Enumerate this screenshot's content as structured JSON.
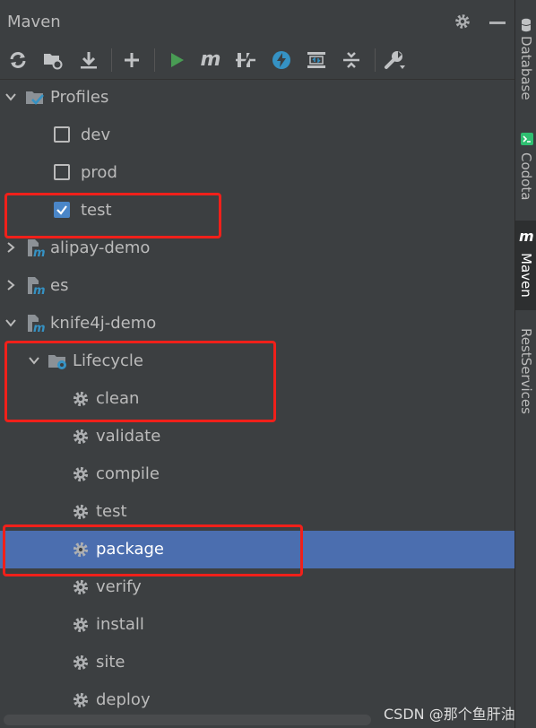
{
  "panel": {
    "title": "Maven"
  },
  "toolbar": {
    "buttons": [
      "reload-icon",
      "generate-sources-icon",
      "download-icon",
      "add-icon",
      "run-icon",
      "maven-goal-icon",
      "toggle-offline-icon",
      "skip-tests-icon",
      "show-dependencies-icon",
      "collapse-all-icon",
      "settings-wrench-icon"
    ]
  },
  "tree": {
    "profiles": {
      "label": "Profiles",
      "items": [
        {
          "label": "dev",
          "checked": false
        },
        {
          "label": "prod",
          "checked": false
        },
        {
          "label": "test",
          "checked": true
        }
      ]
    },
    "projects": [
      {
        "label": "alipay-demo",
        "expanded": false
      },
      {
        "label": "es",
        "expanded": false
      },
      {
        "label": "knife4j-demo",
        "expanded": true
      }
    ],
    "lifecycle": {
      "label": "Lifecycle",
      "goals": [
        "clean",
        "validate",
        "compile",
        "test",
        "package",
        "verify",
        "install",
        "site",
        "deploy"
      ],
      "selected": "package"
    }
  },
  "sidebar": {
    "tabs": [
      {
        "label": "Database",
        "icon": "database-icon"
      },
      {
        "label": "Codota",
        "icon": "codota-icon"
      },
      {
        "label": "Maven",
        "icon": "maven-icon",
        "active": true
      },
      {
        "label": "RestServices",
        "icon": ""
      }
    ]
  },
  "watermark": "CSDN @那个鱼肝油",
  "colors": {
    "selection": "#4b6eaf",
    "highlight_box": "#f0201a",
    "run_green": "#499c54",
    "accent_blue": "#3592c4"
  }
}
